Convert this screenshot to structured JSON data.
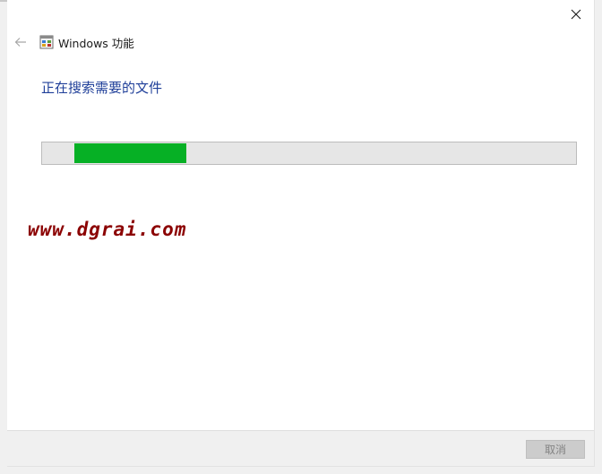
{
  "window": {
    "title": "Windows 功能",
    "close_icon": "close-icon",
    "back_icon": "back-arrow-icon",
    "app_icon": "windows-features-icon"
  },
  "main": {
    "heading": "正在搜索需要的文件",
    "progress": {
      "start_fraction": 0.06,
      "end_fraction": 0.27,
      "fill_color": "#06b025",
      "track_color": "#e6e6e6"
    },
    "watermark": "www.dgrai.com"
  },
  "footer": {
    "cancel_label": "取消",
    "cancel_enabled": false
  },
  "colors": {
    "heading": "#1f3f99",
    "watermark": "#8b0000"
  }
}
